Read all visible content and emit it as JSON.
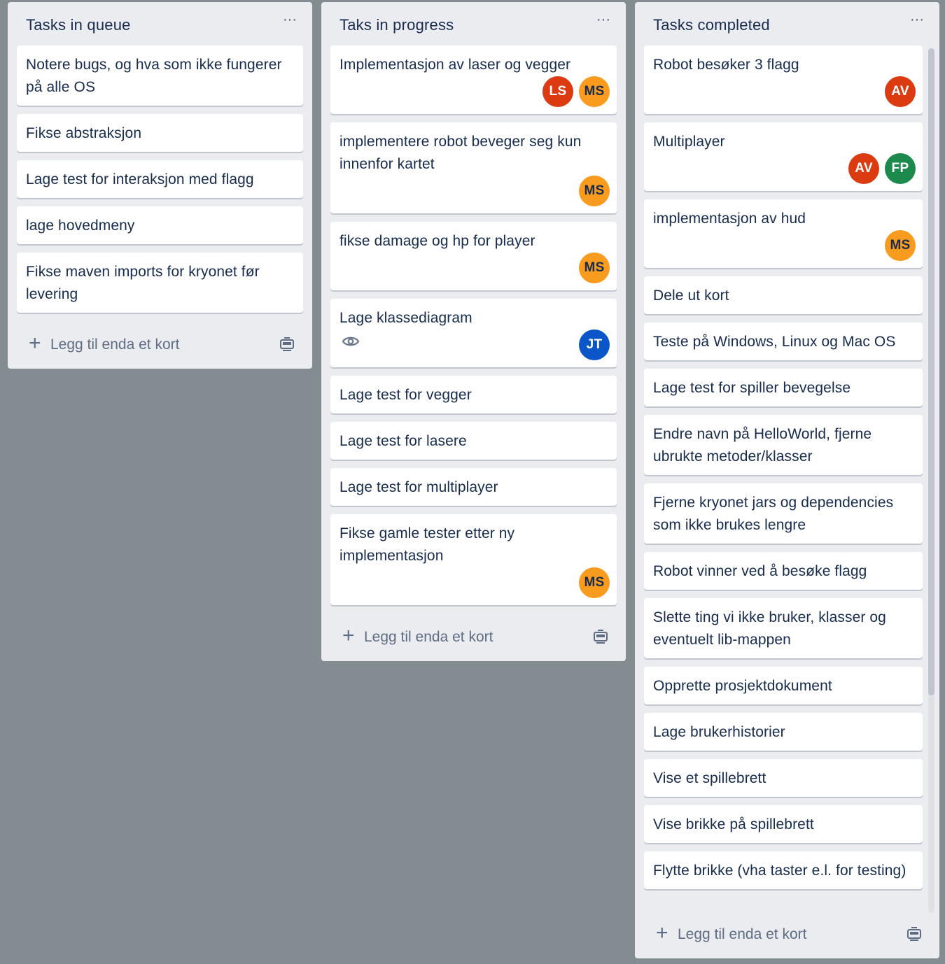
{
  "lists": [
    {
      "title": "Tasks in queue",
      "add_card_label": "Legg til enda et kort",
      "cards": [
        {
          "title": "Notere bugs, og hva som ikke fungerer på alle OS",
          "members": []
        },
        {
          "title": "Fikse abstraksjon",
          "members": []
        },
        {
          "title": "Lage test for interaksjon med flagg",
          "members": []
        },
        {
          "title": "lage hovedmeny",
          "members": []
        },
        {
          "title": "Fikse maven imports for kryonet før levering",
          "members": []
        }
      ]
    },
    {
      "title": "Taks in progress",
      "add_card_label": "Legg til enda et kort",
      "cards": [
        {
          "title": "Implementasjon av laser og vegger",
          "members": [
            "LS",
            "MS"
          ]
        },
        {
          "title": "implementere robot beveger seg kun innenfor kartet",
          "members": [
            "MS"
          ]
        },
        {
          "title": "fikse damage og hp for player",
          "members": [
            "MS"
          ]
        },
        {
          "title": "Lage klassediagram",
          "members": [
            "JT"
          ],
          "watch": true
        },
        {
          "title": "Lage test for vegger",
          "members": []
        },
        {
          "title": "Lage test for lasere",
          "members": []
        },
        {
          "title": "Lage test for multiplayer",
          "members": []
        },
        {
          "title": "Fikse gamle tester etter ny implementasjon",
          "members": [
            "MS"
          ]
        }
      ]
    },
    {
      "title": "Tasks completed",
      "add_card_label": "Legg til enda et kort",
      "cards": [
        {
          "title": "Robot besøker 3 flagg",
          "members": [
            "AV"
          ]
        },
        {
          "title": "Multiplayer",
          "members": [
            "AV",
            "FP"
          ]
        },
        {
          "title": "implementasjon av hud",
          "members": [
            "MS"
          ]
        },
        {
          "title": "Dele ut kort",
          "members": []
        },
        {
          "title": "Teste på Windows, Linux og Mac OS",
          "members": []
        },
        {
          "title": "Lage test for spiller bevegelse",
          "members": []
        },
        {
          "title": "Endre navn på HelloWorld, fjerne ubrukte metoder/klasser",
          "members": []
        },
        {
          "title": "Fjerne kryonet jars og dependencies som ikke brukes lengre",
          "members": []
        },
        {
          "title": "Robot vinner ved å besøke flagg",
          "members": []
        },
        {
          "title": "Slette ting vi ikke bruker, klasser og eventuelt lib-mappen",
          "members": []
        },
        {
          "title": "Opprette prosjektdokument",
          "members": []
        },
        {
          "title": "Lage brukerhistorier",
          "members": []
        },
        {
          "title": "Vise et spillebrett",
          "members": []
        },
        {
          "title": "Vise brikke på spillebrett",
          "members": []
        },
        {
          "title": "Flytte brikke (vha taster e.l. for testing)",
          "members": []
        }
      ]
    }
  ],
  "member_colors": {
    "LS": "#dc3b12",
    "MS": "#f99b1f",
    "AV": "#dc3b12",
    "FP": "#1c8a4c",
    "JT": "#0a56c8"
  },
  "icons": {
    "list_menu": "ellipsis-icon",
    "add": "plus-icon",
    "template": "card-template-icon",
    "watch": "eye-icon"
  }
}
